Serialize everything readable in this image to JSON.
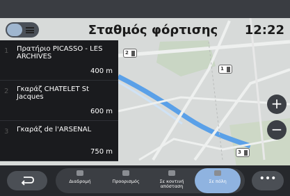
{
  "header": {
    "title": "Σταθμός φόρτισης",
    "clock": "12:22"
  },
  "stations": [
    {
      "number": "1",
      "name": "Πρατήριο PICASSO - LES ARCHIVES",
      "distance": "400 m"
    },
    {
      "number": "2",
      "name": "Γκαράζ CHATELET St Jacques",
      "distance": "600 m"
    },
    {
      "number": "3",
      "name": "Γκαράζ de l'ARSENAL",
      "distance": "750 m"
    }
  ],
  "map_pois": [
    {
      "badge": "2"
    },
    {
      "badge": "1"
    },
    {
      "badge": "3"
    }
  ],
  "zoom": {
    "in": "+",
    "out": "−"
  },
  "tabs": [
    {
      "label": "Διαδρομή",
      "icon": "route-icon"
    },
    {
      "label": "Προορισμός",
      "icon": "flag-icon"
    },
    {
      "label": "Σε κοντινή απόσταση",
      "icon": "car-icon"
    },
    {
      "label": "Σε πόλη",
      "icon": "city-icon",
      "active": true
    }
  ],
  "more": "•••",
  "colors": {
    "accent": "#8fb3e0",
    "panel": "#1a1b1e",
    "route": "#5aa0e8"
  }
}
